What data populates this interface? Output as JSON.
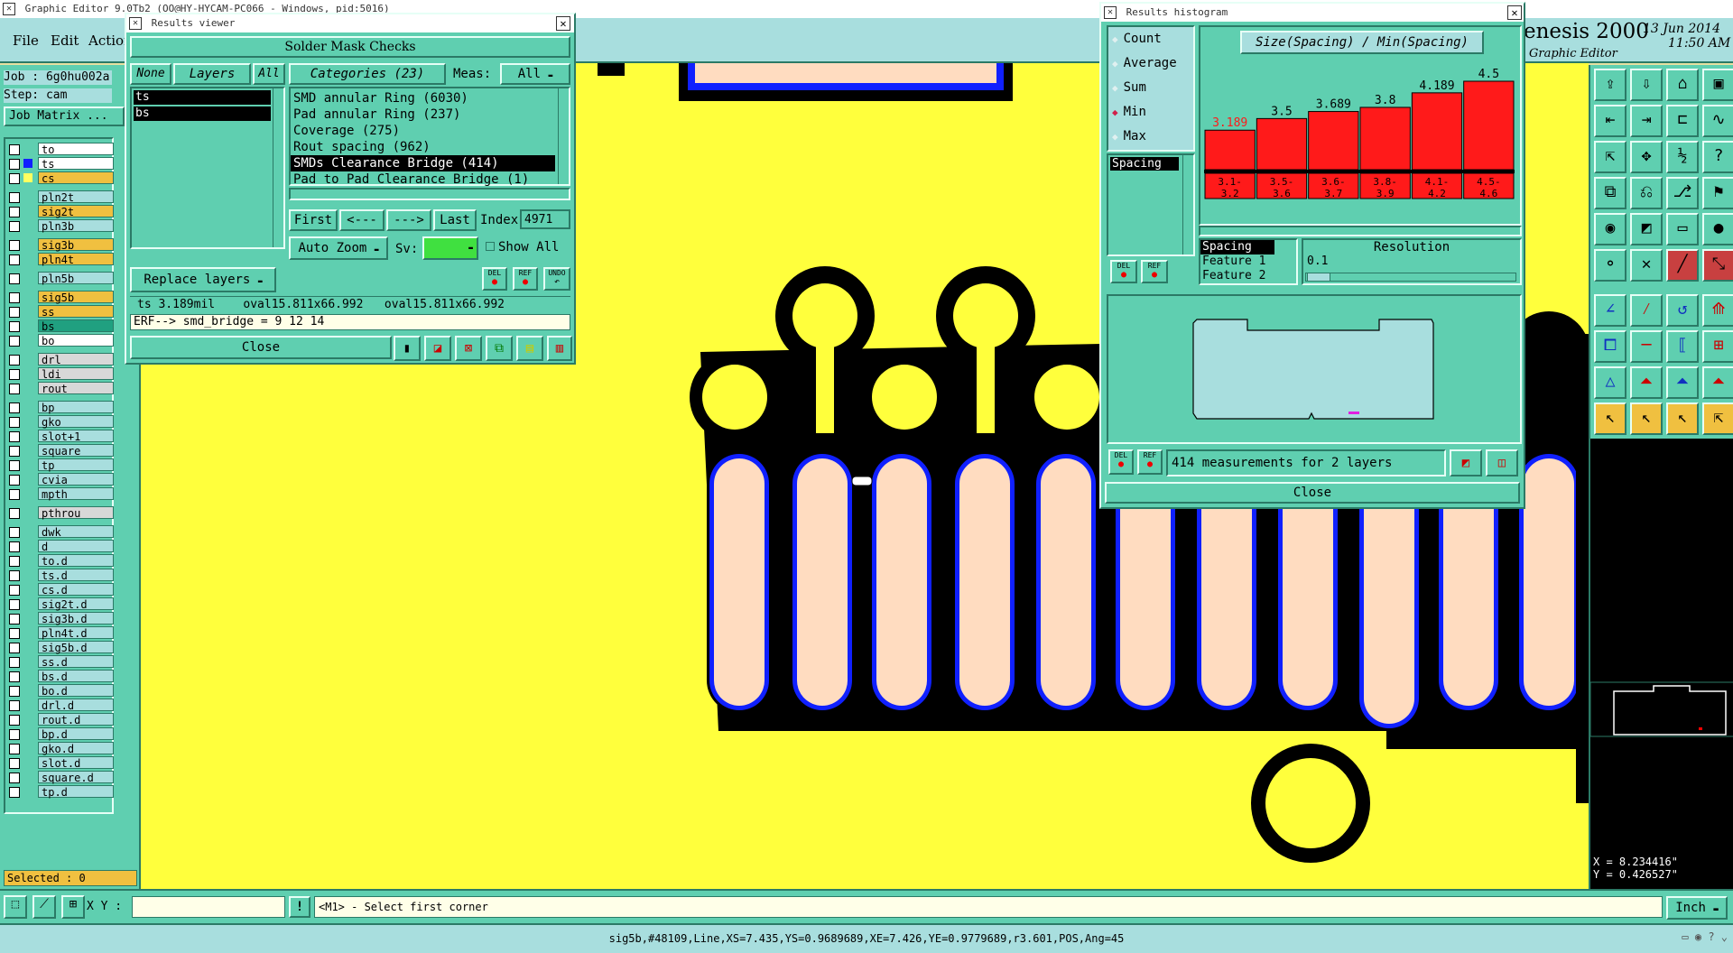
{
  "app": {
    "window_title": "Graphic Editor 9.0Tb2 (OO@HY-HYCAM-PC066 - Windows, pid:5016)",
    "brand_line1": "enesis 2000",
    "brand_line2": "Graphic Editor",
    "date": "13 Jun 2014",
    "time": "11:50 AM"
  },
  "menu": {
    "file": "File",
    "edit": "Edit",
    "action": "Action"
  },
  "job": {
    "job_label": "Job : 6g0hu002a",
    "step_label": "Step: cam",
    "matrix_button": "Job Matrix ..."
  },
  "layers": [
    {
      "name": "to",
      "color": "#ffffff"
    },
    {
      "name": "ts",
      "color": "#ffffff",
      "active": true
    },
    {
      "name": "cs",
      "color": "#f0c040",
      "mark": true
    },
    {
      "name": "pln2t",
      "color": "#a8dede"
    },
    {
      "name": "sig2t",
      "color": "#f0c040"
    },
    {
      "name": "pln3b",
      "color": "#a8dede"
    },
    {
      "name": "sig3b",
      "color": "#f0c040"
    },
    {
      "name": "pln4t",
      "color": "#f0c040"
    },
    {
      "name": "pln5b",
      "color": "#a8dede"
    },
    {
      "name": "sig5b",
      "color": "#f0c040"
    },
    {
      "name": "ss",
      "color": "#f0c040"
    },
    {
      "name": "bs",
      "color": "#20a080"
    },
    {
      "name": "bo",
      "color": "#ffffff"
    },
    {
      "name": "drl",
      "color": "#d8d8d8"
    },
    {
      "name": "ldi",
      "color": "#d8d8d8"
    },
    {
      "name": "rout",
      "color": "#d8d8d8"
    },
    {
      "name": "bp",
      "color": "#a8dede"
    },
    {
      "name": "gko",
      "color": "#a8dede"
    },
    {
      "name": "slot+1",
      "color": "#a8dede"
    },
    {
      "name": "square",
      "color": "#a8dede"
    },
    {
      "name": "tp",
      "color": "#a8dede"
    },
    {
      "name": "cvia",
      "color": "#a8dede"
    },
    {
      "name": "mpth",
      "color": "#a8dede"
    },
    {
      "name": "pthrou",
      "color": "#d8d8d8"
    },
    {
      "name": "dwk",
      "color": "#a8dede"
    },
    {
      "name": "d",
      "color": "#a8dede"
    },
    {
      "name": "to.d",
      "color": "#a8dede"
    },
    {
      "name": "ts.d",
      "color": "#a8dede"
    },
    {
      "name": "cs.d",
      "color": "#a8dede"
    },
    {
      "name": "sig2t.d",
      "color": "#a8dede"
    },
    {
      "name": "sig3b.d",
      "color": "#a8dede"
    },
    {
      "name": "pln4t.d",
      "color": "#a8dede"
    },
    {
      "name": "sig5b.d",
      "color": "#a8dede"
    },
    {
      "name": "ss.d",
      "color": "#a8dede"
    },
    {
      "name": "bs.d",
      "color": "#a8dede"
    },
    {
      "name": "bo.d",
      "color": "#a8dede"
    },
    {
      "name": "drl.d",
      "color": "#a8dede"
    },
    {
      "name": "rout.d",
      "color": "#a8dede"
    },
    {
      "name": "bp.d",
      "color": "#a8dede"
    },
    {
      "name": "gko.d",
      "color": "#a8dede"
    },
    {
      "name": "slot.d",
      "color": "#a8dede"
    },
    {
      "name": "square.d",
      "color": "#a8dede"
    },
    {
      "name": "tp.d",
      "color": "#a8dede"
    }
  ],
  "selected_label": "Selected : 0",
  "results_viewer": {
    "title": "Results viewer",
    "header": "Solder Mask Checks",
    "none_btn": "None",
    "layers_label": "Layers",
    "all_btn": "All",
    "layer_items": [
      "ts",
      "bs"
    ],
    "categories_label": "Categories (23)",
    "meas_label": "Meas:",
    "meas_value": "All",
    "categories": [
      "SMD annular Ring (6030)",
      "Pad annular Ring (237)",
      "Coverage (275)",
      "Rout spacing (962)",
      "SMDs Clearance Bridge (414)",
      "Pad to Pad Clearance Bridge (1)"
    ],
    "selected_category": 4,
    "first_btn": "First",
    "prev_btn": "<---",
    "next_btn": "--->",
    "last_btn": "Last",
    "index_label": "Index:",
    "index_value": "4971",
    "auto_zoom": "Auto Zoom",
    "sv_label": "Sv:",
    "show_all": "Show All",
    "replace_layers": "Replace layers",
    "del": "DEL",
    "ref": "REF",
    "undo": "UNDO",
    "measurement_line": "ts 3.189mil    oval15.811x66.992   oval15.811x66.992",
    "erf_line": "ERF--> smd_bridge = 9 12 14",
    "close": "Close"
  },
  "histogram": {
    "title": "Results histogram",
    "options": [
      "Count",
      "Average",
      "Sum",
      "Min",
      "Max"
    ],
    "selected_option": 3,
    "chart_title": "Size(Spacing) / Min(Spacing)",
    "list_item": "Spacing",
    "bar_labels": [
      "3.189",
      "3.5",
      "3.689",
      "3.8",
      "4.189",
      "4.5"
    ],
    "bar_values": [
      3.189,
      3.5,
      3.689,
      3.8,
      4.189,
      4.5
    ],
    "bin_labels": [
      "3.1-\n3.2",
      "3.5-\n3.6",
      "3.6-\n3.7",
      "3.8-\n3.9",
      "4.1-\n4.2",
      "4.5-\n4.6"
    ],
    "features": [
      "Spacing",
      "Feature 1",
      "Feature 2"
    ],
    "resolution_label": "Resolution",
    "resolution_value": "0.1",
    "del": "DEL",
    "ref": "REF",
    "summary": "414 measurements for 2 layers",
    "close": "Close"
  },
  "chart_data": {
    "type": "bar",
    "title": "Size(Spacing) / Min(Spacing)",
    "categories": [
      "3.1-3.2",
      "3.5-3.6",
      "3.6-3.7",
      "3.8-3.9",
      "4.1-4.2",
      "4.5-4.6"
    ],
    "values": [
      3.189,
      3.5,
      3.689,
      3.8,
      4.189,
      4.5
    ],
    "highlight_index": 0,
    "bar_color": "#ff1a1a"
  },
  "coords": {
    "x": "X = 8.234416\"",
    "y": "Y = 0.426527\""
  },
  "bottom": {
    "xy_label": "X Y :",
    "xy_value": "",
    "hint": "<M1> - Select first corner",
    "units": "Inch",
    "status": "sig5b,#48109,Line,XS=7.435,YS=0.9689689,XE=7.426,YE=0.9779689,r3.601,POS,Ang=45"
  },
  "colors": {
    "canvas": "#ffff3c",
    "copper_mask": "#000000",
    "pad": "#ffdcc0",
    "outline": "#1020ff",
    "panel": "#5fcfb0"
  }
}
